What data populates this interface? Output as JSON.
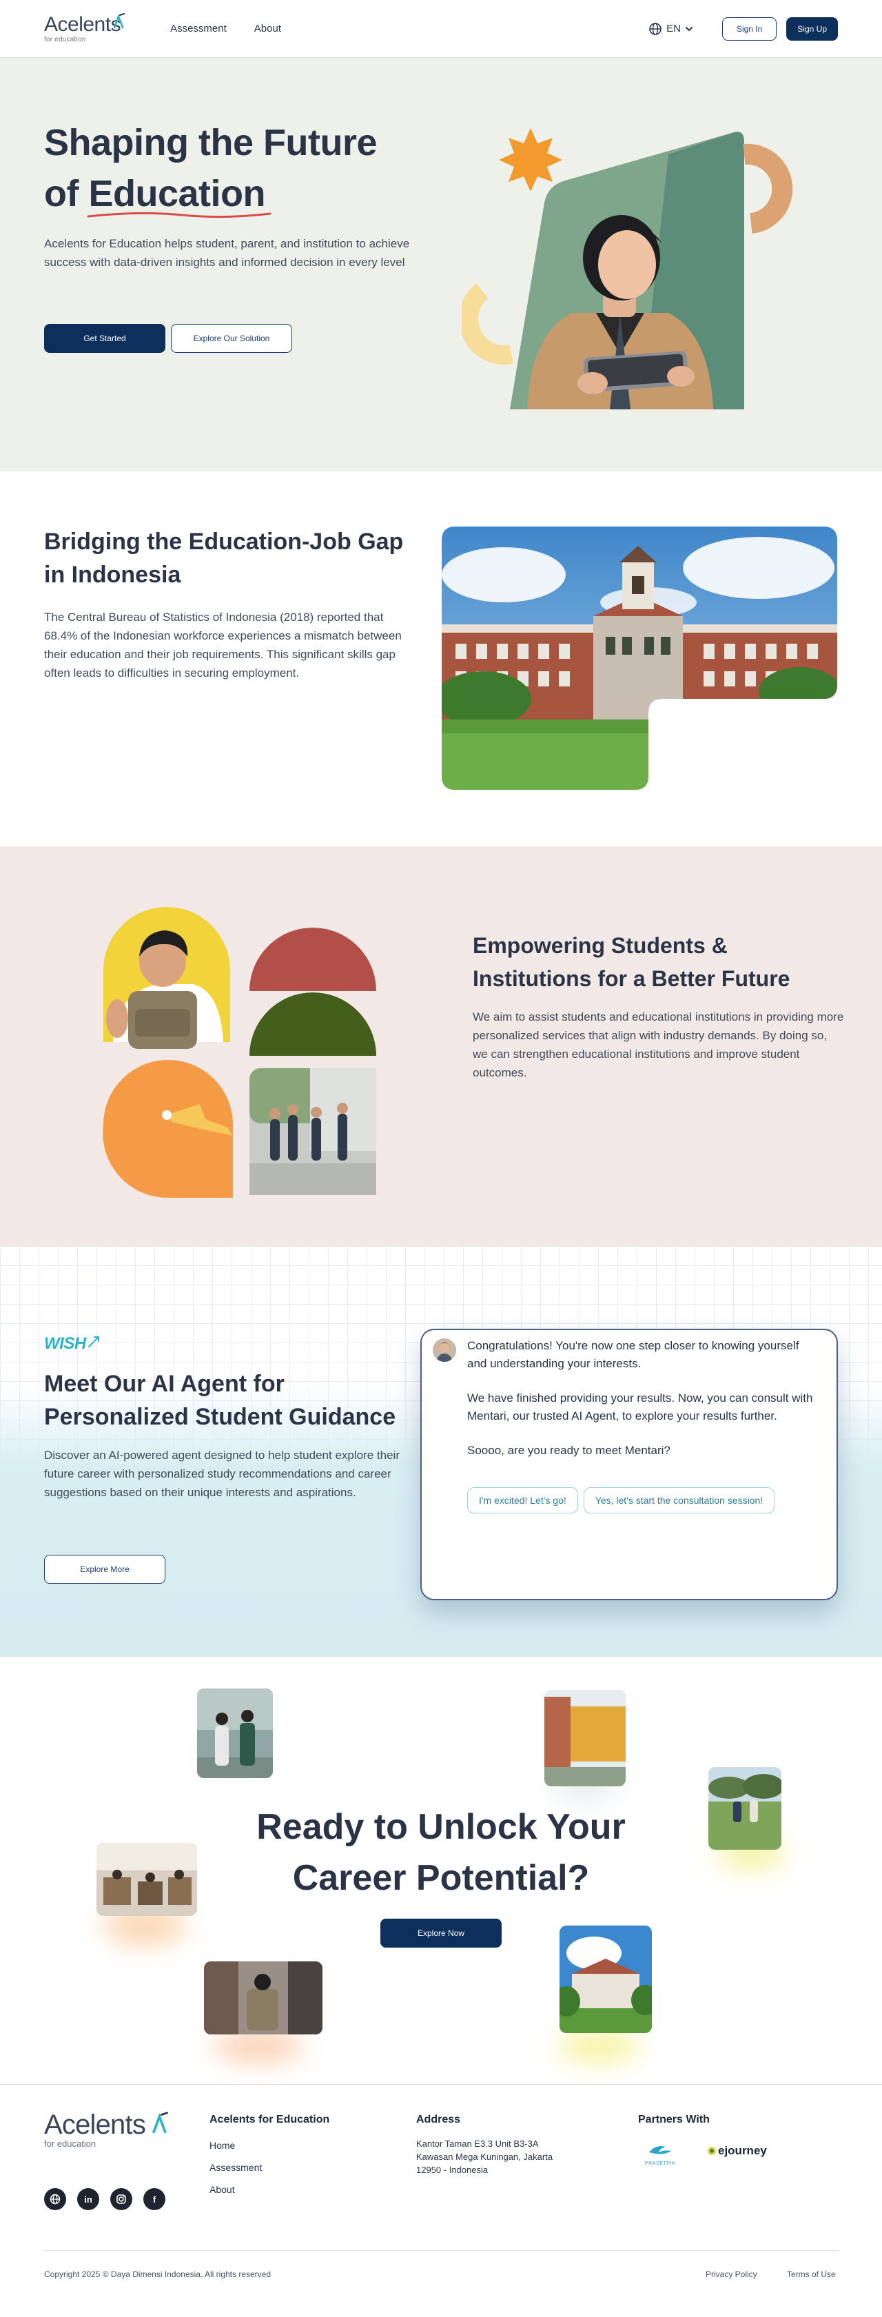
{
  "brand": {
    "name": "Acelents",
    "tagline": "for education"
  },
  "nav": {
    "links": [
      "Assessment",
      "About"
    ],
    "language": "EN",
    "signin": "Sign In",
    "signup": "Sign Up"
  },
  "hero": {
    "title_line1": "Shaping the Future",
    "title_line2": "of Education",
    "description": "Acelents for Education helps student, parent, and institution to achieve success with data-driven insights and informed decision in every level",
    "primary_cta": "Get Started",
    "secondary_cta": "Explore Our Solution"
  },
  "bridge": {
    "title": "Bridging the Education-Job Gap in Indonesia",
    "description": "The Central Bureau of Statistics of Indonesia (2018) reported that 68.4% of the Indonesian workforce experiences a mismatch between their education and their job requirements. This significant skills gap often leads to difficulties in securing employment."
  },
  "empower": {
    "title": "Empowering Students & Institutions for a Better Future",
    "description": "We aim to assist students and educational institutions in providing more personalized services that align with industry demands. By doing so, we can strengthen educational institutions and improve student outcomes."
  },
  "agent": {
    "badge": "WISH",
    "title": "Meet Our AI Agent for Personalized Student Guidance",
    "description": "Discover an AI-powered agent designed to help student explore their future career with personalized study recommendations and career suggestions based on their unique interests and aspirations.",
    "cta": "Explore More",
    "chat": {
      "messages": [
        "Congratulations! You're now one step closer to knowing yourself and understanding your interests.",
        "We have finished providing your results. Now, you can consult with Mentari, our trusted AI Agent, to explore your results further.",
        "Soooo, are you ready to meet Mentari?"
      ],
      "options": [
        "I'm excited! Let's go!",
        "Yes, let's start the consultation session!"
      ]
    }
  },
  "cta": {
    "title_line1": "Ready to Unlock Your",
    "title_line2": "Career Potential?",
    "button": "Explore Now"
  },
  "footer": {
    "col1_title": "Acelents for Education",
    "col1_links": [
      "Home",
      "Assessment",
      "About"
    ],
    "address_title": "Address",
    "address_lines": [
      "Kantor Taman E3.3 Unit B3-3A",
      "Kawasan Mega Kuningan, Jakarta",
      "12950 - Indonesia"
    ],
    "partners_title": "Partners With",
    "partners": [
      "PRASETIYA",
      "ejourney"
    ],
    "social": [
      "globe-icon",
      "linkedin-icon",
      "instagram-icon",
      "facebook-icon"
    ],
    "copyright": "Copyright 2025 © Daya Dimensi Indonesia. All rights reserved",
    "privacy": "Privacy Policy",
    "terms": "Terms of Use"
  },
  "colors": {
    "primary": "#0d2f5c",
    "hero_bg": "#eef1e9",
    "empower_bg": "#f2e9e7",
    "agent_bg": "#d7edf2",
    "accent_red": "#d94b4b",
    "accent_orange": "#f29a2e",
    "accent_teal": "#2ab3c8"
  }
}
